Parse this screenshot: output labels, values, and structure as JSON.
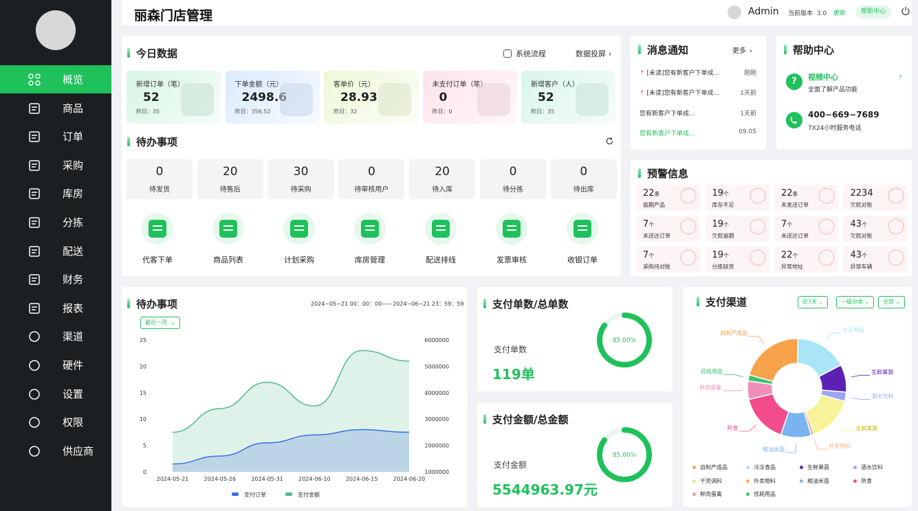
{
  "sidebar": {
    "items": [
      {
        "label": "概览",
        "icon": "grid-icon"
      },
      {
        "label": "商品",
        "icon": "bag-icon"
      },
      {
        "label": "订单",
        "icon": "document-icon"
      },
      {
        "label": "采购",
        "icon": "basket-icon"
      },
      {
        "label": "库房",
        "icon": "warehouse-icon"
      },
      {
        "label": "分拣",
        "icon": "list-icon"
      },
      {
        "label": "配送",
        "icon": "truck-icon"
      },
      {
        "label": "财务",
        "icon": "wallet-icon"
      },
      {
        "label": "报表",
        "icon": "report-icon"
      },
      {
        "label": "渠道",
        "icon": "star-icon"
      },
      {
        "label": "硬件",
        "icon": "hardware-icon"
      },
      {
        "label": "设置",
        "icon": "settings-icon"
      },
      {
        "label": "权限",
        "icon": "trend-icon"
      },
      {
        "label": "供应商",
        "icon": "smile-icon"
      }
    ]
  },
  "header": {
    "title": "丽森门店管理",
    "user": "Admin",
    "version_label": "当前版本",
    "version": "3.0",
    "update": "更新",
    "help": "帮助中心"
  },
  "today": {
    "title": "今日数据",
    "flow": "系统流程",
    "screen": "数据投屏",
    "kpis": [
      {
        "title": "新增订单（笔）",
        "value": "52",
        "yesterday": "昨日：35",
        "color": "#d7f5e4"
      },
      {
        "title": "下单金额（元）",
        "value": "2498.6",
        "yesterday": "昨日：356.52",
        "color": "#dbeafd"
      },
      {
        "title": "客单价（元）",
        "value": "28.93",
        "yesterday": "昨日：32",
        "color": "#eef8d8"
      },
      {
        "title": "未支付订单（笔）",
        "value": "0",
        "yesterday": "昨日：0",
        "color": "#fde3ea"
      },
      {
        "title": "新增客户（人）",
        "value": "52",
        "yesterday": "昨日：35",
        "color": "#d9f5ec"
      }
    ]
  },
  "todo": {
    "title": "待办事项",
    "items": [
      {
        "n": "0",
        "l": "待发货"
      },
      {
        "n": "20",
        "l": "待售后"
      },
      {
        "n": "30",
        "l": "待采购"
      },
      {
        "n": "0",
        "l": "待审核用户"
      },
      {
        "n": "20",
        "l": "待入库"
      },
      {
        "n": "0",
        "l": "待分拣"
      },
      {
        "n": "0",
        "l": "待出库"
      }
    ],
    "quick": [
      {
        "l": "代客下单",
        "icon": "store-icon"
      },
      {
        "l": "商品列表",
        "icon": "clipboard-icon"
      },
      {
        "l": "计划采购",
        "icon": "shopping-bag-icon"
      },
      {
        "l": "库房管理",
        "icon": "warehouse-icon"
      },
      {
        "l": "配送排线",
        "icon": "truck-icon"
      },
      {
        "l": "发票审核",
        "icon": "invoice-icon"
      },
      {
        "l": "收银订单",
        "icon": "receipt-icon"
      }
    ]
  },
  "messages": {
    "title": "消息通知",
    "more": "更多",
    "items": [
      {
        "text": "[未读]您有新客户下单成...",
        "time": "刚刚",
        "unread": true
      },
      {
        "text": "[未读]您有新客户下单成...",
        "time": "1天前",
        "unread": true
      },
      {
        "text": "您有新客户下单成...",
        "time": "1天前",
        "unread": false
      },
      {
        "text": "您有新客户下单成...",
        "time": "09.05",
        "unread": false,
        "highlight": true
      }
    ]
  },
  "help": {
    "title": "帮助中心",
    "video_title": "视频中心",
    "video_desc": "全面了解产品功能",
    "phone": "400−669−7689",
    "phone_desc": "7X24小时服务电话"
  },
  "warnings": {
    "title": "预警信息",
    "items": [
      {
        "v": "22",
        "u": "条",
        "l": "临期产品"
      },
      {
        "v": "19",
        "u": "个",
        "l": "库存不足"
      },
      {
        "v": "22",
        "u": "条",
        "l": "未发送订单"
      },
      {
        "v": "2234",
        "u": "",
        "l": "欠款对账"
      },
      {
        "v": "7",
        "u": "个",
        "l": "未送达订单"
      },
      {
        "v": "19",
        "u": "个",
        "l": "欠款逾期"
      },
      {
        "v": "7",
        "u": "个",
        "l": "未送达订单"
      },
      {
        "v": "43",
        "u": "个",
        "l": "欠款对账"
      },
      {
        "v": "7",
        "u": "个",
        "l": "采购待对账"
      },
      {
        "v": "19",
        "u": "个",
        "l": "分拣缺货"
      },
      {
        "v": "22",
        "u": "个",
        "l": "异常地址"
      },
      {
        "v": "43",
        "u": "个",
        "l": "异常车辆"
      }
    ]
  },
  "trend": {
    "title": "待办事项",
    "range": "2024−05−21 00：00：00——2024−06−21 23：59：59",
    "filter": "最近一月"
  },
  "chart_data": [
    {
      "type": "area",
      "x": [
        "2024-05-21",
        "2024-05-26",
        "2024-05-31",
        "2024-06-10",
        "2024-06-15",
        "2024-06-20"
      ],
      "series": [
        {
          "name": "支付订单",
          "axis": "left",
          "color": "#3b6fe0",
          "values": [
            1.5,
            3,
            5.5,
            7,
            8,
            7.5
          ]
        },
        {
          "name": "支付金额",
          "axis": "right",
          "color": "#4fb98b",
          "values": [
            2500000,
            3400000,
            4400000,
            3500000,
            5600000,
            5200000
          ]
        }
      ],
      "ylim": [
        0,
        25
      ],
      "yticks": [
        0,
        5,
        10,
        15,
        20,
        25
      ],
      "y2lim": [
        1000000,
        6000000
      ],
      "y2ticks": [
        1000000,
        2000000,
        3000000,
        4000000,
        5000000,
        6000000
      ],
      "legend": "bottom"
    },
    {
      "type": "pie",
      "title": "支付渠道",
      "legend": "bottom",
      "slices": [
        {
          "name": "冷冻食品",
          "value": 17,
          "color": "#a9e4f7"
        },
        {
          "name": "生鲜果蔬",
          "value": 9,
          "color": "#5b21b6"
        },
        {
          "name": "酒水饮料",
          "value": 3,
          "color": "#9da4f2"
        },
        {
          "name": "生鲜果蔬",
          "value": 15,
          "color": "#f8f39a"
        },
        {
          "name": "外卖物料",
          "value": 1,
          "color": "#f4b183"
        },
        {
          "name": "粮油米面",
          "value": 10,
          "color": "#7ab4f0"
        },
        {
          "name": "熟食",
          "value": 16,
          "color": "#f24c8d"
        },
        {
          "name": "鲜肉蛋禽",
          "value": 6,
          "color": "#ef8fb9"
        },
        {
          "name": "低耗用品",
          "value": 2,
          "color": "#3cc46b"
        },
        {
          "name": "自制产成品",
          "value": 21,
          "color": "#f8a24b"
        }
      ]
    }
  ],
  "pay_count": {
    "title": "支付单数/总单数",
    "label": "支付单数",
    "value": "119单",
    "pct_text": "85.00%",
    "pct": 0.85
  },
  "pay_amount": {
    "title": "支付金额/总金额",
    "label": "支付金额",
    "value": "5544963.97元",
    "pct_text": "85.00%",
    "pct": 0.85
  },
  "channel": {
    "title": "支付渠道",
    "filters": [
      "近7天",
      "一级分类",
      "全部"
    ],
    "legend": [
      {
        "n": "自制产成品",
        "c": "#f8a24b"
      },
      {
        "n": "冷冻食品",
        "c": "#a9e4f7"
      },
      {
        "n": "生鲜果蔬",
        "c": "#5b21b6"
      },
      {
        "n": "酒水饮料",
        "c": "#9da4f2"
      },
      {
        "n": "干货调料",
        "c": "#f7e27a"
      },
      {
        "n": "外卖物料",
        "c": "#f6b73c"
      },
      {
        "n": "粮油米面",
        "c": "#7ab4f0"
      },
      {
        "n": "熟食",
        "c": "#f24c8d"
      },
      {
        "n": "鲜肉蛋禽",
        "c": "#ef8fb9"
      },
      {
        "n": "低耗用品",
        "c": "#3cc46b"
      }
    ]
  }
}
